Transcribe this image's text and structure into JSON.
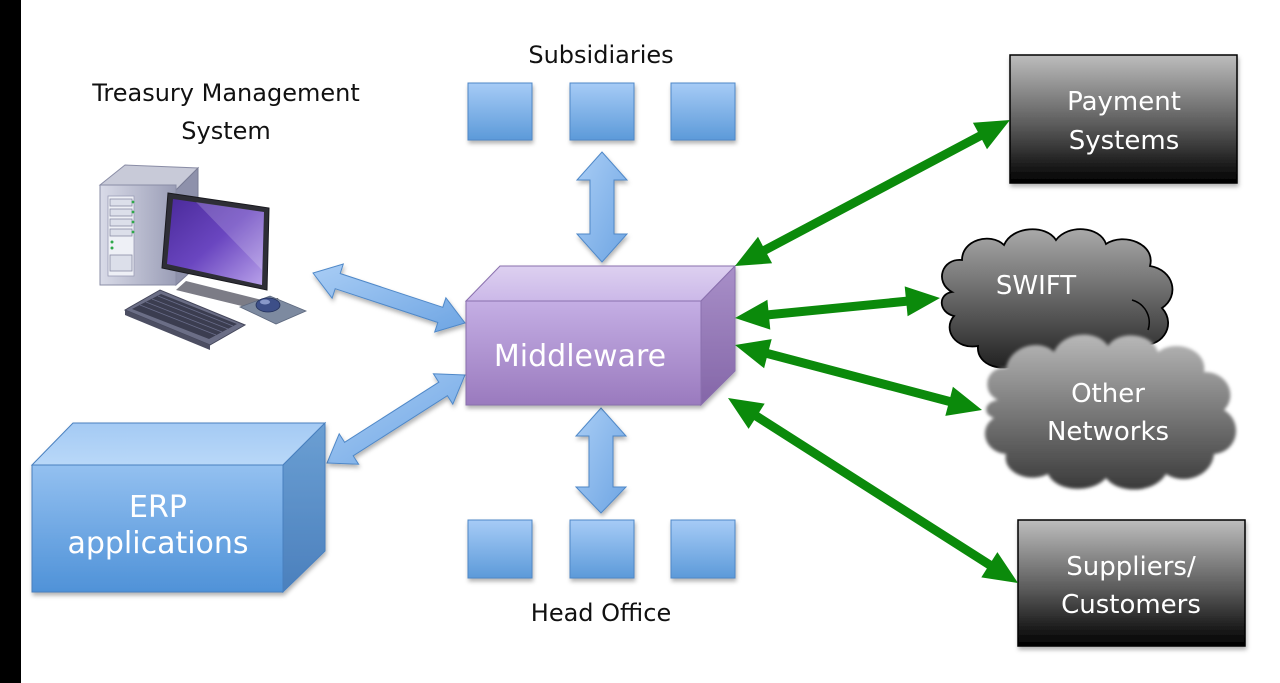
{
  "labels": {
    "tms_line1": "Treasury Management",
    "tms_line2": "System",
    "subsidiaries": "Subsidiaries",
    "head_office": "Head Office",
    "middleware": "Middleware",
    "erp_line1": "ERP",
    "erp_line2": "applications",
    "payment_line1": "Payment",
    "payment_line2": "Systems",
    "swift": "SWIFT",
    "other_line1": "Other",
    "other_line2": "Networks",
    "suppliers_line1": "Suppliers/",
    "suppliers_line2": "Customers"
  },
  "colors": {
    "blue_node": "#6aa3e0",
    "blue_arrow": "#7fb2ea",
    "purple_node": "#b39ad6",
    "green_arrow": "#0b8a0b",
    "dark_box": "#1a1a1a"
  },
  "connections": {
    "internal": [
      "tms-middleware",
      "erp-middleware",
      "subsidiaries-middleware",
      "headoffice-middleware"
    ],
    "external": [
      "middleware-payment",
      "middleware-swift",
      "middleware-other-networks",
      "middleware-suppliers"
    ]
  }
}
